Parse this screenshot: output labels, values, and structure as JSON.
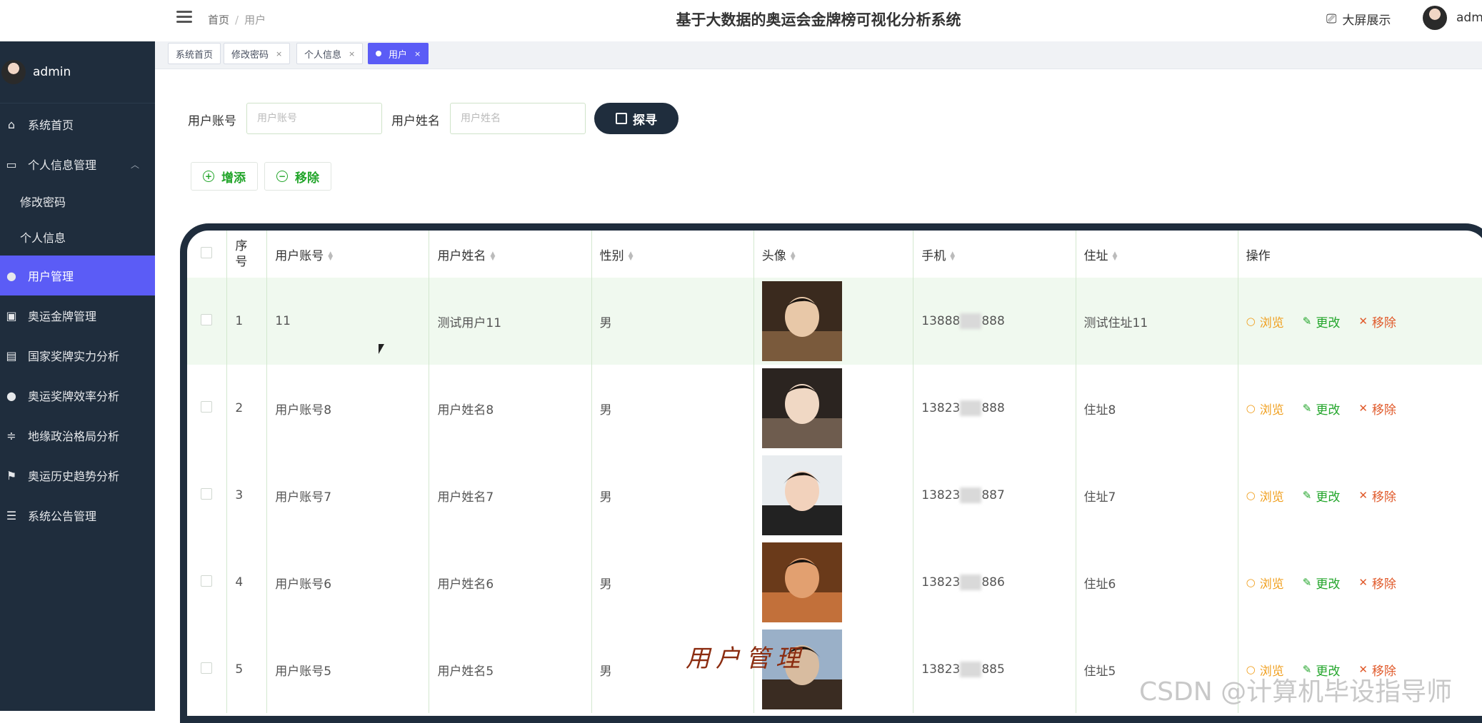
{
  "app": {
    "title": "基于大数据的奥运会金牌榜可视化分析系统",
    "big_screen": "大屏展示",
    "user": "adm"
  },
  "breadcrumb": {
    "home": "首页",
    "sep": "/",
    "current": "用户"
  },
  "sidebar": {
    "user": "admin",
    "items": [
      {
        "label": "系统首页",
        "icon": "home-icon"
      },
      {
        "label": "个人信息管理",
        "icon": "card-icon"
      },
      {
        "label": "修改密码"
      },
      {
        "label": "个人信息"
      },
      {
        "label": "用户管理",
        "icon": "user-icon"
      },
      {
        "label": "奥运金牌管理",
        "icon": "clipboard-icon"
      },
      {
        "label": "国家奖牌实力分析",
        "icon": "id-card-icon"
      },
      {
        "label": "奥运奖牌效率分析",
        "icon": "bulb-icon"
      },
      {
        "label": "地缘政治格局分析",
        "icon": "sliders-icon"
      },
      {
        "label": "奥运历史趋势分析",
        "icon": "flag-icon"
      },
      {
        "label": "系统公告管理",
        "icon": "list-icon"
      }
    ]
  },
  "tags": [
    {
      "label": "系统首页"
    },
    {
      "label": "修改密码",
      "close": "×"
    },
    {
      "label": "个人信息",
      "close": "×"
    },
    {
      "label": "用户",
      "close": "×"
    }
  ],
  "search": {
    "account_label": "用户账号",
    "account_placeholder": "用户账号",
    "name_label": "用户姓名",
    "name_placeholder": "用户姓名",
    "button": "探寻"
  },
  "actions": {
    "add": "增添",
    "remove": "移除"
  },
  "table": {
    "headers": [
      "序号",
      "用户账号",
      "用户姓名",
      "性别",
      "头像",
      "手机",
      "住址",
      "操作"
    ],
    "ops": {
      "view": "浏览",
      "edit": "更改",
      "delete": "移除"
    },
    "rows": [
      {
        "no": "1",
        "account": "11",
        "name": "测试用户11",
        "gender": "男",
        "phone_a": "13888",
        "phone_b": "888",
        "address": "测试住址11"
      },
      {
        "no": "2",
        "account": "用户账号8",
        "name": "用户姓名8",
        "gender": "男",
        "phone_a": "13823",
        "phone_b": "888",
        "address": "住址8"
      },
      {
        "no": "3",
        "account": "用户账号7",
        "name": "用户姓名7",
        "gender": "男",
        "phone_a": "13823",
        "phone_b": "887",
        "address": "住址7"
      },
      {
        "no": "4",
        "account": "用户账号6",
        "name": "用户姓名6",
        "gender": "男",
        "phone_a": "13823",
        "phone_b": "886",
        "address": "住址6"
      },
      {
        "no": "5",
        "account": "用户账号5",
        "name": "用户姓名5",
        "gender": "男",
        "phone_a": "13823",
        "phone_b": "885",
        "address": "住址5"
      }
    ]
  },
  "overlay": {
    "caption": "用户管理",
    "watermark": "CSDN @计算机毕设指导师"
  }
}
